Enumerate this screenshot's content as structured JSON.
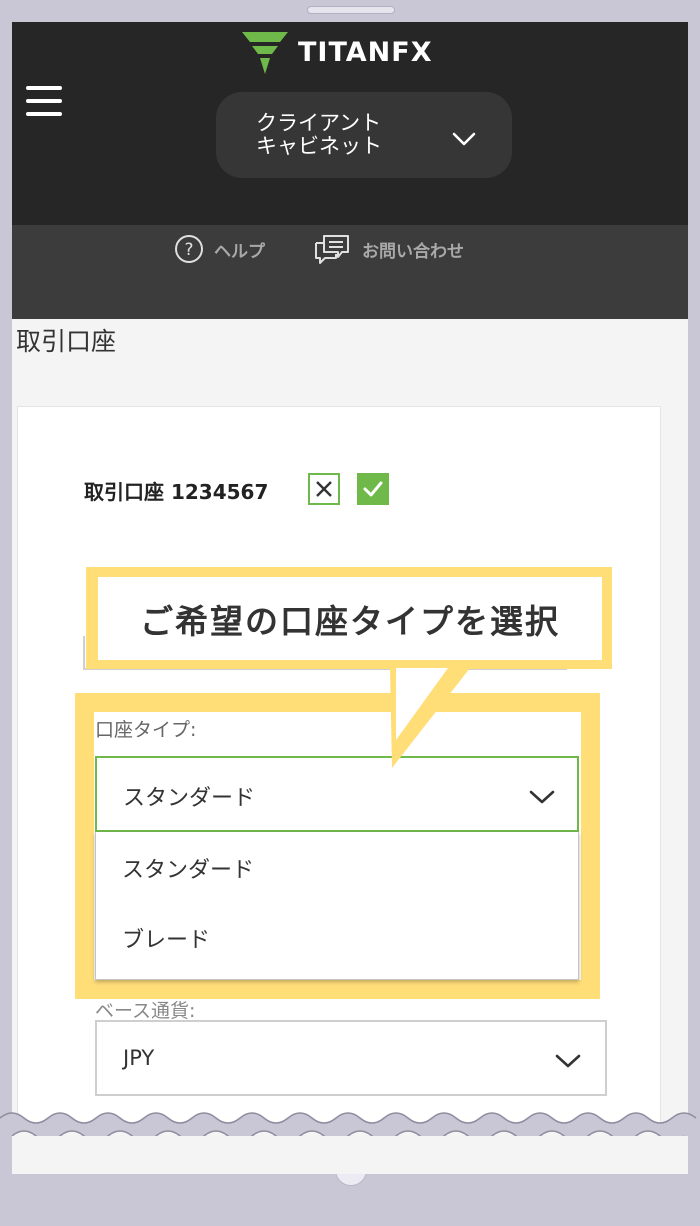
{
  "header": {
    "logo_text": "TITANFX",
    "cabinet_label": "クライアント\nキャビネット"
  },
  "subnav": {
    "help_label": "ヘルプ",
    "contact_label": "お問い合わせ"
  },
  "page": {
    "title": "取引口座"
  },
  "account": {
    "heading": "取引口座 1234567"
  },
  "callout": {
    "text": "ご希望の口座タイプを選択"
  },
  "form": {
    "account_type_label": "口座タイプ:",
    "account_type_value": "スタンダード",
    "account_type_options": [
      "スタンダード",
      "ブレード"
    ],
    "base_currency_label": "ベース通貨:",
    "base_currency_value": "JPY"
  },
  "colors": {
    "header_bg": "#262626",
    "subnav_bg": "#3c3c3c",
    "accent_green": "#6fb84a",
    "highlight_yellow": "#ffde78"
  }
}
